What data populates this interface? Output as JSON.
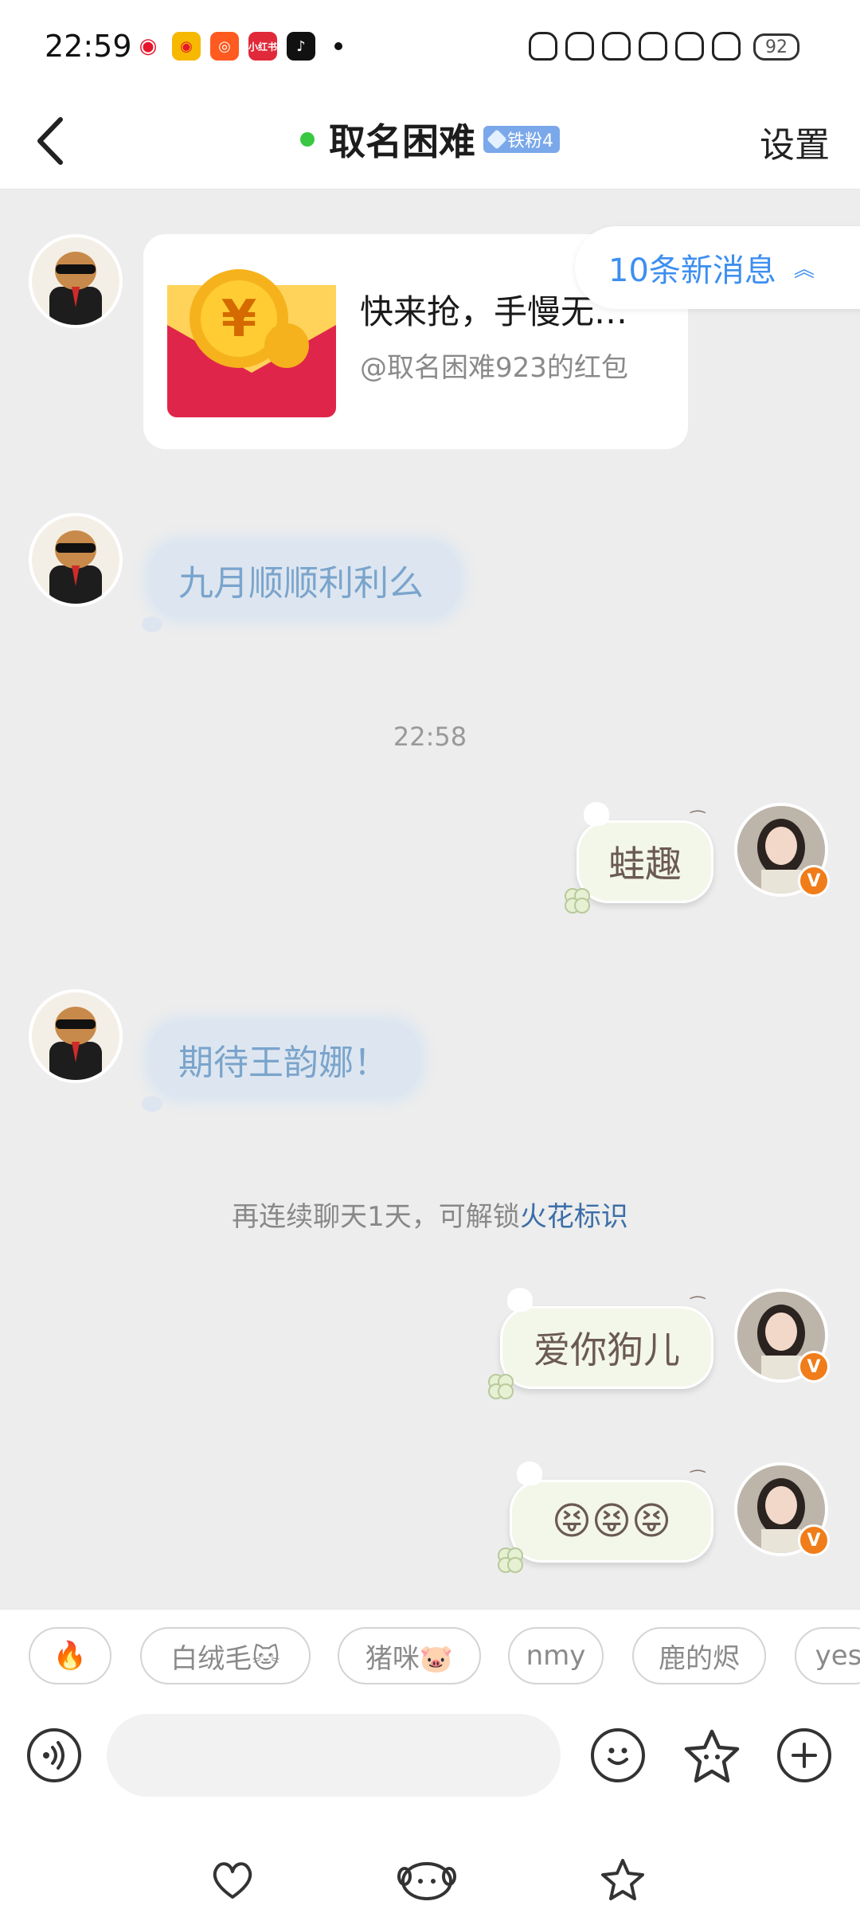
{
  "status_bar": {
    "time": "22:59",
    "battery": "92",
    "app_icons": [
      "weibo-icon",
      "weibo-alt-icon",
      "kuaishou-icon",
      "xiaohongshu-icon",
      "douyin-icon"
    ]
  },
  "header": {
    "title": "取名困难",
    "fan_badge": "铁粉4",
    "settings_label": "设置",
    "online_color": "#38c842"
  },
  "new_messages": {
    "label": "10条新消息"
  },
  "messages": {
    "red_packet": {
      "title": "快来抢，手慢无…",
      "subtitle": "@取名困难923的红包"
    },
    "msg_1": "九月顺顺利利么",
    "timestamp": "22:58",
    "msg_2": "蛙趣",
    "msg_3": "期待王韵娜！",
    "system_note": {
      "text": "再连续聊天1天，可解锁",
      "link": "火花标识"
    },
    "msg_4": "爱你狗儿",
    "msg_5": "😝😝😝"
  },
  "quick_replies": [
    "🔥",
    "白绒毛🐱",
    "猪咪🐷",
    "nmy",
    "鹿的烬",
    "yes"
  ],
  "colors": {
    "accent_blue": "#3d8ff0",
    "link_blue": "#3b6ea8",
    "verified_orange": "#f07d1a",
    "packet_red": "#e0254a"
  }
}
